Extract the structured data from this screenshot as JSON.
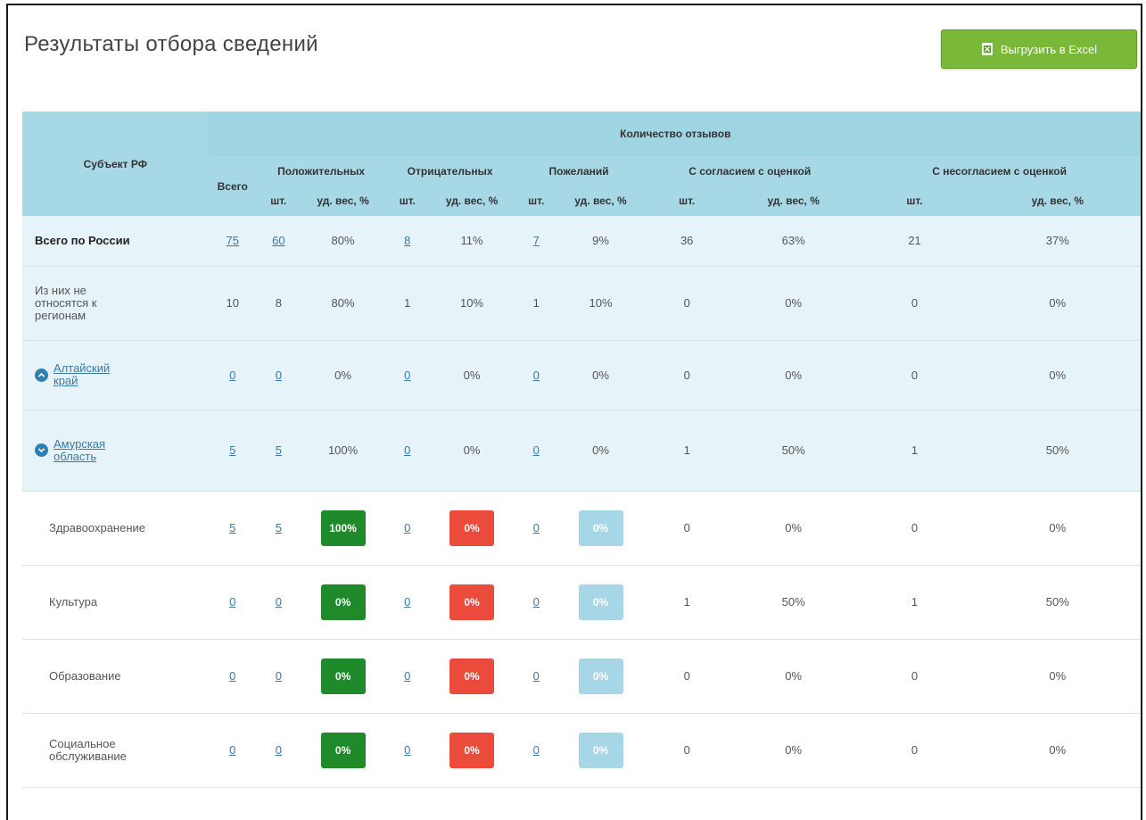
{
  "page": {
    "title": "Результаты отбора сведений"
  },
  "toolbar": {
    "export_label": "Выгрузить в Excel"
  },
  "table": {
    "headers": {
      "subject": "Субъект РФ",
      "reviews_count": "Количество отзывов",
      "total": "Всего",
      "positive": "Положительных",
      "negative": "Отрицательных",
      "wishes": "Пожеланий",
      "agree": "С согласием с оценкой",
      "disagree": "С несогласием с оценкой",
      "pcs": "шт.",
      "share": "уд. вес, %"
    },
    "rows": [
      {
        "name": "Всего по России",
        "total": "75",
        "pos": "60",
        "pos_pct": "80%",
        "neg": "8",
        "neg_pct": "11%",
        "wish": "7",
        "wish_pct": "9%",
        "agr": "36",
        "agr_pct": "63%",
        "dis": "21",
        "dis_pct": "37%"
      },
      {
        "name": "Из них не относятся к регионам",
        "total": "10",
        "pos": "8",
        "pos_pct": "80%",
        "neg": "1",
        "neg_pct": "10%",
        "wish": "1",
        "wish_pct": "10%",
        "agr": "0",
        "agr_pct": "0%",
        "dis": "0",
        "dis_pct": "0%"
      },
      {
        "name": "Алтайский край",
        "total": "0",
        "pos": "0",
        "pos_pct": "0%",
        "neg": "0",
        "neg_pct": "0%",
        "wish": "0",
        "wish_pct": "0%",
        "agr": "0",
        "agr_pct": "0%",
        "dis": "0",
        "dis_pct": "0%"
      },
      {
        "name": "Амурская область",
        "total": "5",
        "pos": "5",
        "pos_pct": "100%",
        "neg": "0",
        "neg_pct": "0%",
        "wish": "0",
        "wish_pct": "0%",
        "agr": "1",
        "agr_pct": "50%",
        "dis": "1",
        "dis_pct": "50%"
      },
      {
        "name": "Здравоохранение",
        "total": "5",
        "pos": "5",
        "pos_pct": "100%",
        "neg": "0",
        "neg_pct": "0%",
        "wish": "0",
        "wish_pct": "0%",
        "agr": "0",
        "agr_pct": "0%",
        "dis": "0",
        "dis_pct": "0%"
      },
      {
        "name": "Культура",
        "total": "0",
        "pos": "0",
        "pos_pct": "0%",
        "neg": "0",
        "neg_pct": "0%",
        "wish": "0",
        "wish_pct": "0%",
        "agr": "1",
        "agr_pct": "50%",
        "dis": "1",
        "dis_pct": "50%"
      },
      {
        "name": "Образование",
        "total": "0",
        "pos": "0",
        "pos_pct": "0%",
        "neg": "0",
        "neg_pct": "0%",
        "wish": "0",
        "wish_pct": "0%",
        "agr": "0",
        "agr_pct": "0%",
        "dis": "0",
        "dis_pct": "0%"
      },
      {
        "name": "Социальное обслуживание",
        "total": "0",
        "pos": "0",
        "pos_pct": "0%",
        "neg": "0",
        "neg_pct": "0%",
        "wish": "0",
        "wish_pct": "0%",
        "agr": "0",
        "agr_pct": "0%",
        "dis": "0",
        "dis_pct": "0%"
      }
    ]
  },
  "colors": {
    "header_bg": "#a6d8e6",
    "region_row_bg": "#e6f3f8",
    "export_button": "#7ab83a",
    "badge_positive": "#1e8a2a",
    "badge_negative": "#ea4b3b",
    "badge_wishes": "#a7d7e6",
    "link": "#3a78a8"
  },
  "icons": {
    "export": "excel-icon",
    "region_toggle": "chevron-circle-icon"
  }
}
